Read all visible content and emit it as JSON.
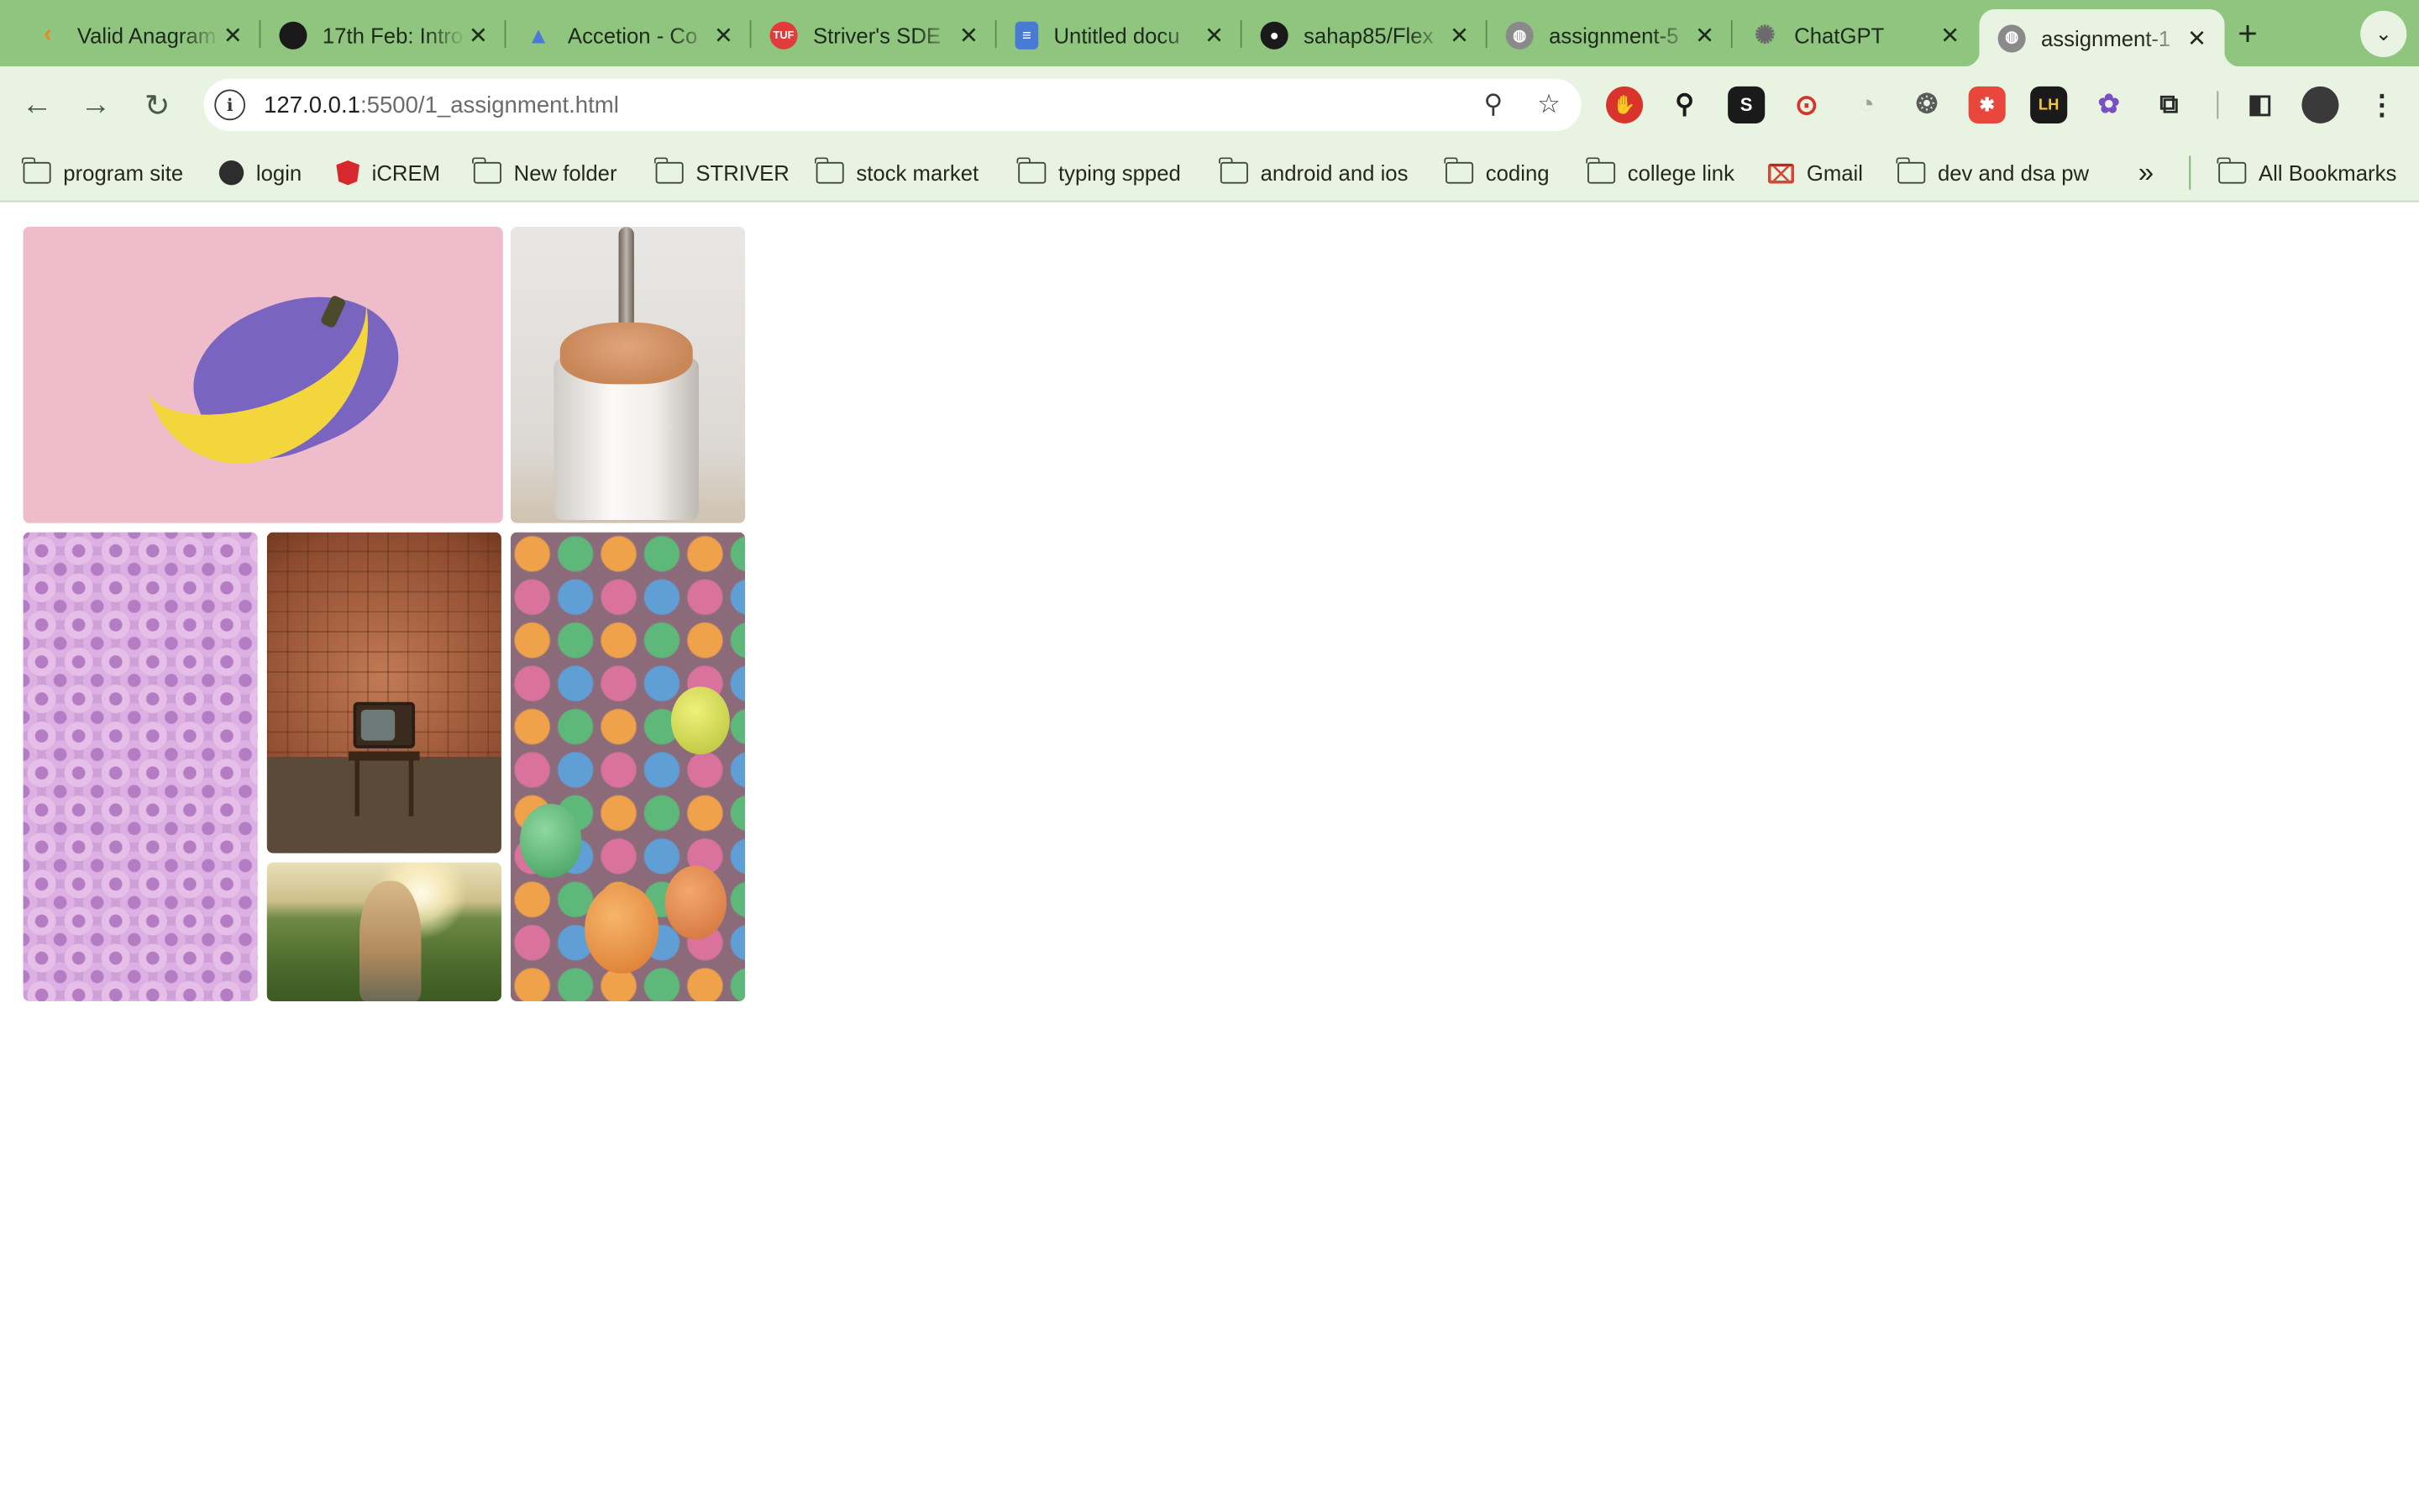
{
  "browser": {
    "tabs": [
      {
        "title": "Valid Anagram",
        "favicon": "code-icon",
        "favicon_color": "#e58a2b",
        "active": false
      },
      {
        "title": "17th Feb: Intro",
        "favicon": "page-icon",
        "favicon_color": "#1a1a1a",
        "active": false
      },
      {
        "title": "Accetion - Co",
        "favicon": "triangle-icon",
        "favicon_color": "#4a7bd4",
        "active": false
      },
      {
        "title": "Striver's SDE",
        "favicon": "tuf-icon",
        "favicon_color": "#e23b3b",
        "active": false
      },
      {
        "title": "Untitled docu",
        "favicon": "docs-icon",
        "favicon_color": "#4a7bd4",
        "active": false
      },
      {
        "title": "sahap85/Flex",
        "favicon": "github-icon",
        "favicon_color": "#1a1a1a",
        "active": false
      },
      {
        "title": "assignment-5",
        "favicon": "globe-icon",
        "favicon_color": "#6b6b6b",
        "active": false
      },
      {
        "title": "ChatGPT",
        "favicon": "chatgpt-icon",
        "favicon_color": "#6b6b6b",
        "active": false
      },
      {
        "title": "assignment-1",
        "favicon": "globe-icon",
        "favicon_color": "#6b6b6b",
        "active": true
      }
    ],
    "close_glyph": "✕",
    "new_tab_glyph": "+",
    "address": {
      "host": "127.0.0.1",
      "rest": ":5500/1_assignment.html"
    },
    "bookmarks": [
      {
        "label": "program site",
        "icon": "folder-icon"
      },
      {
        "label": "login",
        "icon": "globe-icon"
      },
      {
        "label": "iCREM",
        "icon": "angular-icon"
      },
      {
        "label": "New folder",
        "icon": "folder-icon"
      },
      {
        "label": "STRIVER",
        "icon": "folder-icon"
      },
      {
        "label": "stock market",
        "icon": "folder-icon"
      },
      {
        "label": "typing spped",
        "icon": "folder-icon"
      },
      {
        "label": "android and ios",
        "icon": "folder-icon"
      },
      {
        "label": "coding",
        "icon": "folder-icon"
      },
      {
        "label": "college link",
        "icon": "folder-icon"
      },
      {
        "label": "Gmail",
        "icon": "gmail-icon"
      },
      {
        "label": "dev and dsa pw",
        "icon": "folder-icon"
      }
    ],
    "all_bookmarks_label": "All Bookmarks",
    "overflow_glyph": "»",
    "colors": {
      "tabstrip": "#8fc57f",
      "toolbar": "#e8f3e2"
    }
  },
  "page": {
    "images": [
      {
        "name": "banana-image",
        "subject": "banana on pink background"
      },
      {
        "name": "caramel-jar-image",
        "subject": "spoon in caramel jar"
      },
      {
        "name": "pink-rings-image",
        "subject": "pink cereal rings"
      },
      {
        "name": "retro-tv-image",
        "subject": "retro tv on chair"
      },
      {
        "name": "colorful-eggs-image",
        "subject": "colorful textured eggs"
      },
      {
        "name": "field-girl-image",
        "subject": "girl in sunlit field"
      }
    ]
  }
}
